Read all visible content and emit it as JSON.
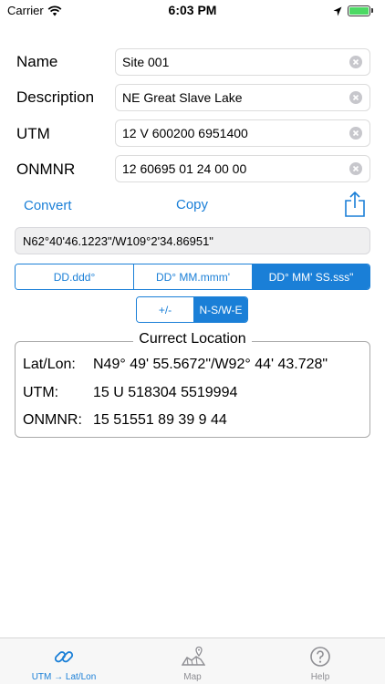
{
  "status_bar": {
    "carrier": "Carrier",
    "time": "6:03 PM",
    "battery_level": 1.0,
    "battery_color": "#4cd964"
  },
  "form": {
    "name_label": "Name",
    "name_value": "Site 001",
    "description_label": "Description",
    "description_value": "NE Great Slave Lake",
    "utm_label": "UTM",
    "utm_value": "12 V 600200 6951400",
    "onmnr_label": "ONMNR",
    "onmnr_value": "12 60695 01 24 00 00"
  },
  "actions": {
    "convert_label": "Convert",
    "copy_label": "Copy",
    "share_icon": "share-icon"
  },
  "result": {
    "value": "N62°40'46.1223\"/W109°2'34.86951\""
  },
  "format_selector": {
    "options": [
      "DD.ddd°",
      "DD° MM.mmm'",
      "DD° MM' SS.sss\""
    ],
    "selected_index": 2
  },
  "sign_selector": {
    "options": [
      "+/-",
      "N-S/W-E"
    ],
    "selected_index": 1
  },
  "current_location": {
    "title": "Currect Location",
    "latlon_label": "Lat/Lon:",
    "latlon_value": "N49° 49' 55.5672\"/W92° 44' 43.728\"",
    "utm_label": "UTM:",
    "utm_value": "15 U 518304 5519994",
    "onmnr_label": "ONMNR:",
    "onmnr_value": "15 51551 89 39 9 44"
  },
  "tab_bar": {
    "tabs": [
      {
        "label": "UTM → Lat/Lon",
        "icon": "link-icon",
        "active": true
      },
      {
        "label": "Map",
        "icon": "map-icon",
        "active": false
      },
      {
        "label": "Help",
        "icon": "help-icon",
        "active": false
      }
    ]
  },
  "colors": {
    "accent": "#1a7fd7",
    "inactive_tab": "#8e8e93"
  }
}
